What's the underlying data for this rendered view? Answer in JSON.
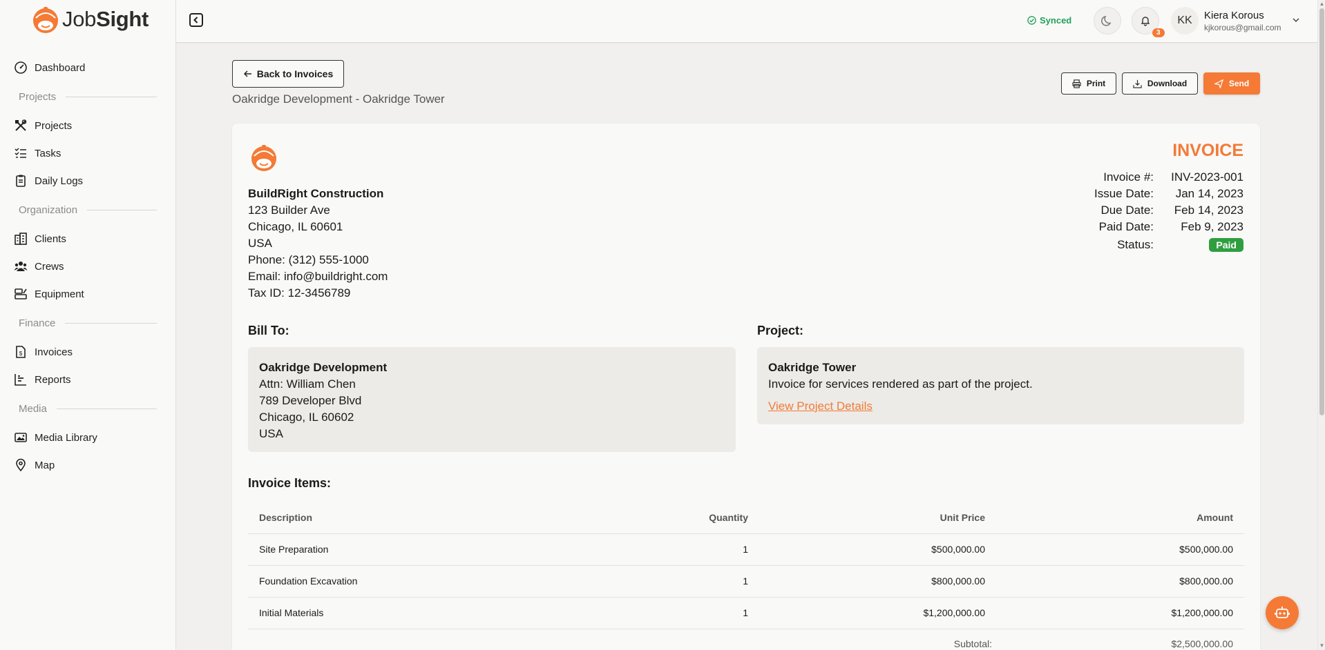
{
  "app": {
    "brand_job": "Job",
    "brand_sight": "Sight"
  },
  "sidebar": {
    "dashboard": "Dashboard",
    "sections": {
      "projects": "Projects",
      "organization": "Organization",
      "finance": "Finance",
      "media": "Media"
    },
    "items": {
      "projects": "Projects",
      "tasks": "Tasks",
      "daily_logs": "Daily Logs",
      "clients": "Clients",
      "crews": "Crews",
      "equipment": "Equipment",
      "invoices": "Invoices",
      "reports": "Reports",
      "media_library": "Media Library",
      "map": "Map"
    }
  },
  "header": {
    "sync_status": "Synced",
    "notification_count": "3",
    "user_initials": "KK",
    "user_name": "Kiera Korous",
    "user_email": "kjkorous@gmail.com"
  },
  "page": {
    "back_label": "Back to Invoices",
    "subtitle": "Oakridge Development - Oakridge Tower",
    "actions": {
      "print": "Print",
      "download": "Download",
      "send": "Send"
    }
  },
  "invoice": {
    "title": "INVOICE",
    "company": {
      "name": "BuildRight Construction",
      "address1": "123 Builder Ave",
      "address2": "Chicago, IL 60601",
      "country": "USA",
      "phone": "Phone: (312) 555-1000",
      "email": "Email: info@buildright.com",
      "tax_id": "Tax ID: 12-3456789"
    },
    "meta": {
      "number_label": "Invoice #:",
      "number": "INV-2023-001",
      "issue_label": "Issue Date:",
      "issue": "Jan 14, 2023",
      "due_label": "Due Date:",
      "due": "Feb 14, 2023",
      "paid_label": "Paid Date:",
      "paid": "Feb 9, 2023",
      "status_label": "Status:",
      "status": "Paid"
    },
    "bill_to": {
      "heading": "Bill To:",
      "name": "Oakridge Development",
      "attn": "Attn: William Chen",
      "address1": "789 Developer Blvd",
      "address2": "Chicago, IL 60602",
      "country": "USA"
    },
    "project": {
      "heading": "Project:",
      "name": "Oakridge Tower",
      "description": "Invoice for services rendered as part of the project.",
      "link": "View Project Details"
    },
    "items_heading": "Invoice Items:",
    "columns": {
      "description": "Description",
      "quantity": "Quantity",
      "unit_price": "Unit Price",
      "amount": "Amount"
    },
    "items": [
      {
        "description": "Site Preparation",
        "quantity": "1",
        "unit_price": "$500,000.00",
        "amount": "$500,000.00"
      },
      {
        "description": "Foundation Excavation",
        "quantity": "1",
        "unit_price": "$800,000.00",
        "amount": "$800,000.00"
      },
      {
        "description": "Initial Materials",
        "quantity": "1",
        "unit_price": "$1,200,000.00",
        "amount": "$1,200,000.00"
      }
    ],
    "subtotal_label": "Subtotal:",
    "subtotal": "$2,500,000.00"
  },
  "colors": {
    "accent": "#f47a36",
    "success": "#2f9e3f",
    "synced": "#22a05a"
  },
  "icons": {
    "logo": "hardhat-face-icon",
    "chat": "robot-icon"
  }
}
